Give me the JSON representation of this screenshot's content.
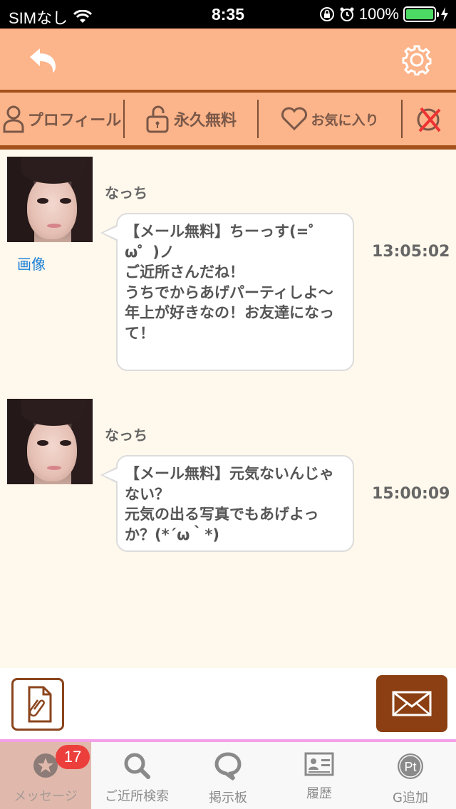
{
  "status_bar": {
    "carrier": "SIMなし",
    "time": "8:35",
    "battery": "100%"
  },
  "header": {
    "back_icon": "undo-arrow-icon",
    "settings_icon": "gear-icon"
  },
  "tabs": {
    "profile": "プロフィール",
    "free": "永久無料",
    "favorite": "お気に入り",
    "block_icon": "block-icon"
  },
  "messages": [
    {
      "sender": "なっち",
      "image_link": "画像",
      "text": "【メール無料】ちーっす(=゜ω゜)ノ\nご近所さんだね！\nうちでからあげパーティしよ〜\n年上が好きなの！お友達になって！",
      "time": "13:05:02"
    },
    {
      "sender": "なっち",
      "text": "【メール無料】元気ないんじゃない？\n元気の出る写真でもあげよっか？(*´ω｀*)",
      "time": "15:00:09"
    }
  ],
  "input": {
    "attach_icon": "attachment-clip-icon",
    "send_icon": "envelope-icon"
  },
  "bottom_nav": [
    {
      "label": "メッセージ",
      "icon": "star-circle-icon",
      "badge": "17",
      "active": true
    },
    {
      "label": "ご近所検索",
      "icon": "search-icon"
    },
    {
      "label": "掲示板",
      "icon": "speech-bubble-icon"
    },
    {
      "label": "履歴",
      "icon": "id-card-icon"
    },
    {
      "label": "G追加",
      "icon": "pt-coin-icon"
    }
  ],
  "colors": {
    "header_bg": "#fcb48a",
    "accent_brown": "#a4511c",
    "send_button": "#8b3f12",
    "background": "#fff8ec",
    "badge_red": "#ec3f3c",
    "link_blue": "#1a7fd6"
  }
}
